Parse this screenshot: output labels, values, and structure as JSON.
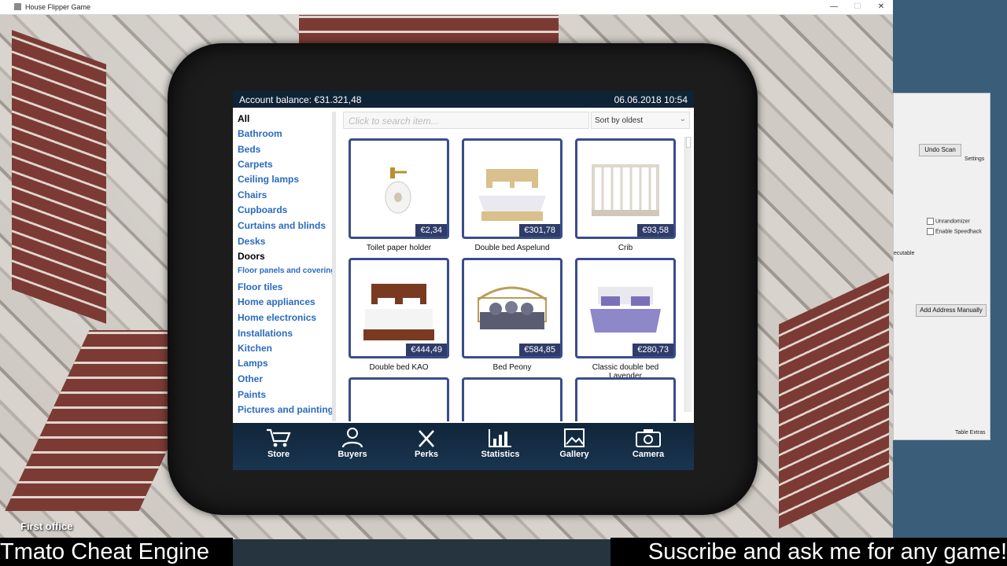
{
  "window": {
    "title": "House Flipper Game",
    "minimize": "—",
    "maximize": "☐",
    "close": "✕"
  },
  "tablet": {
    "account_balance": "Account balance:  €31.321,48",
    "datetime": "06.06.2018 10:54",
    "search_placeholder": "Click to search item...",
    "sort_label": "Sort by oldest",
    "categories": [
      {
        "label": "All"
      },
      {
        "label": "Bathroom"
      },
      {
        "label": "Beds"
      },
      {
        "label": "Carpets"
      },
      {
        "label": "Ceiling lamps"
      },
      {
        "label": "Chairs"
      },
      {
        "label": "Cupboards"
      },
      {
        "label": "Curtains and blinds"
      },
      {
        "label": "Desks"
      },
      {
        "label": "Doors"
      },
      {
        "label": "Floor panels and coverings"
      },
      {
        "label": "Floor tiles"
      },
      {
        "label": "Home appliances"
      },
      {
        "label": "Home electronics"
      },
      {
        "label": "Installations"
      },
      {
        "label": "Kitchen"
      },
      {
        "label": "Lamps"
      },
      {
        "label": "Other"
      },
      {
        "label": "Paints"
      },
      {
        "label": "Pictures and paintings"
      }
    ],
    "items": [
      {
        "name": "Toilet paper holder",
        "price": "€2,34"
      },
      {
        "name": "Double bed Aspelund",
        "price": "€301,78"
      },
      {
        "name": "Crib",
        "price": "€93,58"
      },
      {
        "name": "Double bed KAO",
        "price": "€444,49"
      },
      {
        "name": "Bed Peony",
        "price": "€584,85"
      },
      {
        "name": "Classic double bed Lavender",
        "price": "€280,73"
      }
    ],
    "nav": [
      {
        "label": "Store",
        "icon": "cart-icon"
      },
      {
        "label": "Buyers",
        "icon": "person-money-icon"
      },
      {
        "label": "Perks",
        "icon": "tools-icon"
      },
      {
        "label": "Statistics",
        "icon": "chart-icon"
      },
      {
        "label": "Gallery",
        "icon": "gallery-icon"
      },
      {
        "label": "Camera",
        "icon": "camera-icon"
      }
    ]
  },
  "hud": {
    "location": "First office"
  },
  "cheat_engine": {
    "undo_scan": "Undo Scan",
    "settings": "Settings",
    "unrandomizer": "Unrandomizer",
    "enable_speedhack": "Enable Speedhack",
    "executable": "ecutable",
    "add_address": "Add Address Manually",
    "table_extras": "Table Extras"
  },
  "overlay": {
    "left_banner": "Tmato Cheat Engine",
    "right_banner": "Suscribe and ask me for any game!"
  }
}
